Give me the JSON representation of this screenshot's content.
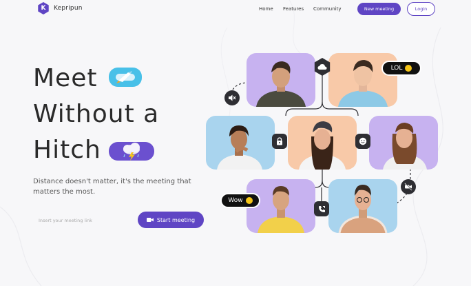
{
  "brand": {
    "name": "Kepripun",
    "logo_letter": "K",
    "color": "#5f45c4"
  },
  "nav": {
    "links": [
      "Home",
      "Features",
      "Community"
    ],
    "new_meeting": "New meeting",
    "login": "Login"
  },
  "hero": {
    "line1": "Meet",
    "line2": "Without a",
    "line3": "Hitch",
    "subtitle": "Distance doesn't matter, it's the meeting that matters the most."
  },
  "meeting_form": {
    "placeholder": "Insert your meeting link",
    "start_label": "Start meeting"
  },
  "bubbles": {
    "lol": "LOL",
    "wow": "Wow"
  },
  "colors": {
    "accent": "#5f45c4",
    "tile_purple": "#c7b2f0",
    "tile_peach": "#f8c9a8",
    "tile_blue": "#a9d4ee",
    "icon_dark": "#2e2e33"
  },
  "icons": [
    "rocket-icon",
    "cloud-storm-icon",
    "mute-icon",
    "cloud-icon",
    "lock-icon",
    "smile-icon",
    "video-off-icon",
    "phone-icon",
    "video-icon"
  ]
}
